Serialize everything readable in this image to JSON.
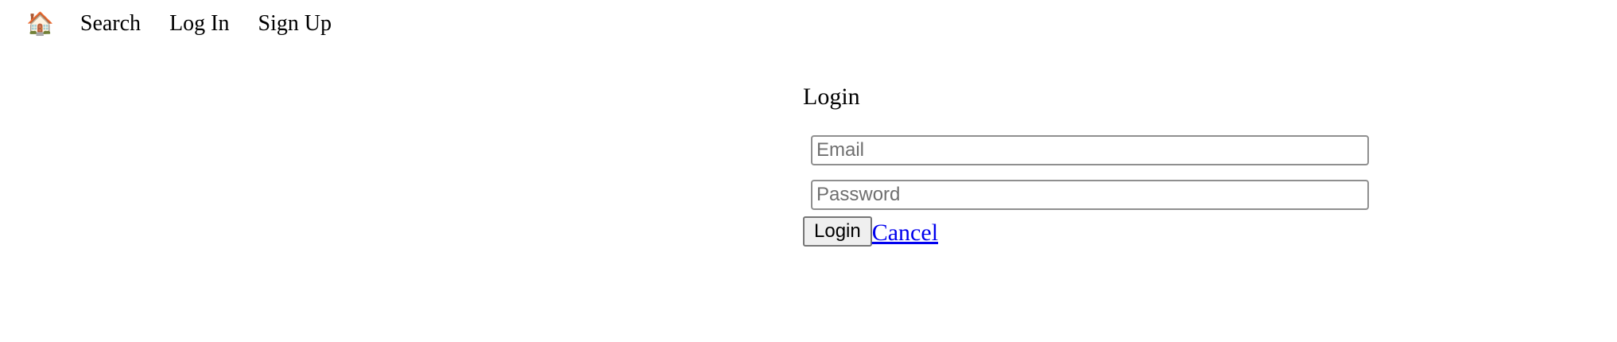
{
  "nav": {
    "home_icon": "🏠",
    "home_icon_name": "house-icon",
    "items": [
      {
        "label": "Search"
      },
      {
        "label": "Log In"
      },
      {
        "label": "Sign Up"
      }
    ]
  },
  "login": {
    "title": "Login",
    "email": {
      "value": "",
      "placeholder": "Email"
    },
    "password": {
      "value": "",
      "placeholder": "Password"
    },
    "submit_label": "Login",
    "cancel_label": "Cancel"
  },
  "colors": {
    "link": "#0000ee",
    "input_border": "#8f8f8f",
    "button_bg": "#efefef"
  }
}
